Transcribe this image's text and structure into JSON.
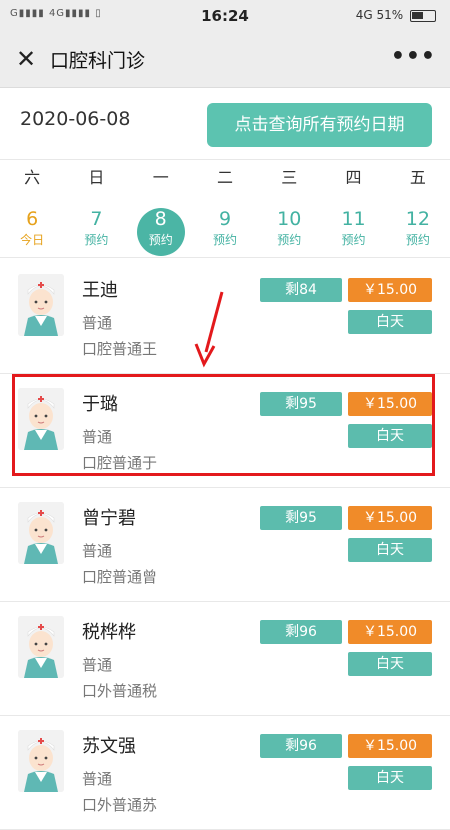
{
  "status": {
    "left": "G▮▮▮▮ 4G▮▮▮▮ ▯",
    "time": "16:24",
    "right": "4G 51%"
  },
  "nav": {
    "close_icon": "close-icon",
    "title": "口腔科门诊",
    "more": "•••"
  },
  "header": {
    "date": "2020-06-08",
    "query_button": "点击查询所有预约日期"
  },
  "weekdays": [
    "六",
    "日",
    "一",
    "二",
    "三",
    "四",
    "五"
  ],
  "days": [
    {
      "num": "6",
      "sub": "今日"
    },
    {
      "num": "7",
      "sub": "预约"
    },
    {
      "num": "8",
      "sub": "预约"
    },
    {
      "num": "9",
      "sub": "预约"
    },
    {
      "num": "10",
      "sub": "预约"
    },
    {
      "num": "11",
      "sub": "预约"
    },
    {
      "num": "12",
      "sub": "预约"
    }
  ],
  "doctors": [
    {
      "name": "王迪",
      "type": "普通",
      "dept": "口腔普通王",
      "remain": "剩84",
      "price": "￥15.00",
      "period": "白天"
    },
    {
      "name": "于璐",
      "type": "普通",
      "dept": "口腔普通于",
      "remain": "剩95",
      "price": "￥15.00",
      "period": "白天"
    },
    {
      "name": "曾宁碧",
      "type": "普通",
      "dept": "口腔普通曾",
      "remain": "剩95",
      "price": "￥15.00",
      "period": "白天"
    },
    {
      "name": "税桦桦",
      "type": "普通",
      "dept": "口外普通税",
      "remain": "剩96",
      "price": "￥15.00",
      "period": "白天"
    },
    {
      "name": "苏文强",
      "type": "普通",
      "dept": "口外普通苏",
      "remain": "剩96",
      "price": "￥15.00",
      "period": "白天"
    }
  ],
  "colors": {
    "accent": "#5cbcad",
    "today": "#e6a21c",
    "price": "#f08b29",
    "highlight": "#e3191c"
  }
}
